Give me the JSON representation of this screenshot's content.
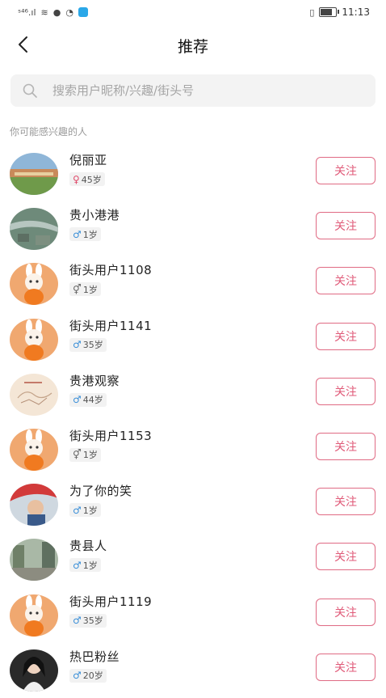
{
  "status_bar": {
    "signal": "ˢ⁴⁶.ıl",
    "time": "11:13"
  },
  "header": {
    "title": "推荐"
  },
  "search": {
    "placeholder": "搜索用户昵称/兴趣/街头号"
  },
  "section_label": "你可能感兴趣的人",
  "follow_label": "关注",
  "users": [
    {
      "name": "倪丽亚",
      "gender": "female",
      "gender_symbol": "♀",
      "age": "45岁",
      "avatar": "landscape-field"
    },
    {
      "name": "贵小港港",
      "gender": "male",
      "gender_symbol": "♂",
      "age": "1岁",
      "avatar": "city-aerial"
    },
    {
      "name": "街头用户1108",
      "gender": "unknown",
      "gender_symbol": "⚥",
      "age": "1岁",
      "avatar": "orange-bunny"
    },
    {
      "name": "街头用户1141",
      "gender": "male",
      "gender_symbol": "♂",
      "age": "35岁",
      "avatar": "orange-bunny"
    },
    {
      "name": "贵港观察",
      "gender": "male",
      "gender_symbol": "♂",
      "age": "44岁",
      "avatar": "map-sketch"
    },
    {
      "name": "街头用户1153",
      "gender": "unknown",
      "gender_symbol": "⚥",
      "age": "1岁",
      "avatar": "orange-bunny"
    },
    {
      "name": "为了你的笑",
      "gender": "male",
      "gender_symbol": "♂",
      "age": "1岁",
      "avatar": "child-photo"
    },
    {
      "name": "贵县人",
      "gender": "male",
      "gender_symbol": "♂",
      "age": "1岁",
      "avatar": "street-photo"
    },
    {
      "name": "街头用户1119",
      "gender": "male",
      "gender_symbol": "♂",
      "age": "35岁",
      "avatar": "orange-bunny"
    },
    {
      "name": "热巴粉丝",
      "gender": "male",
      "gender_symbol": "♂",
      "age": "20岁",
      "avatar": "woman-photo"
    }
  ],
  "colors": {
    "accent": "#e05a78",
    "female": "#e04a6a",
    "male": "#3a8fd8"
  }
}
